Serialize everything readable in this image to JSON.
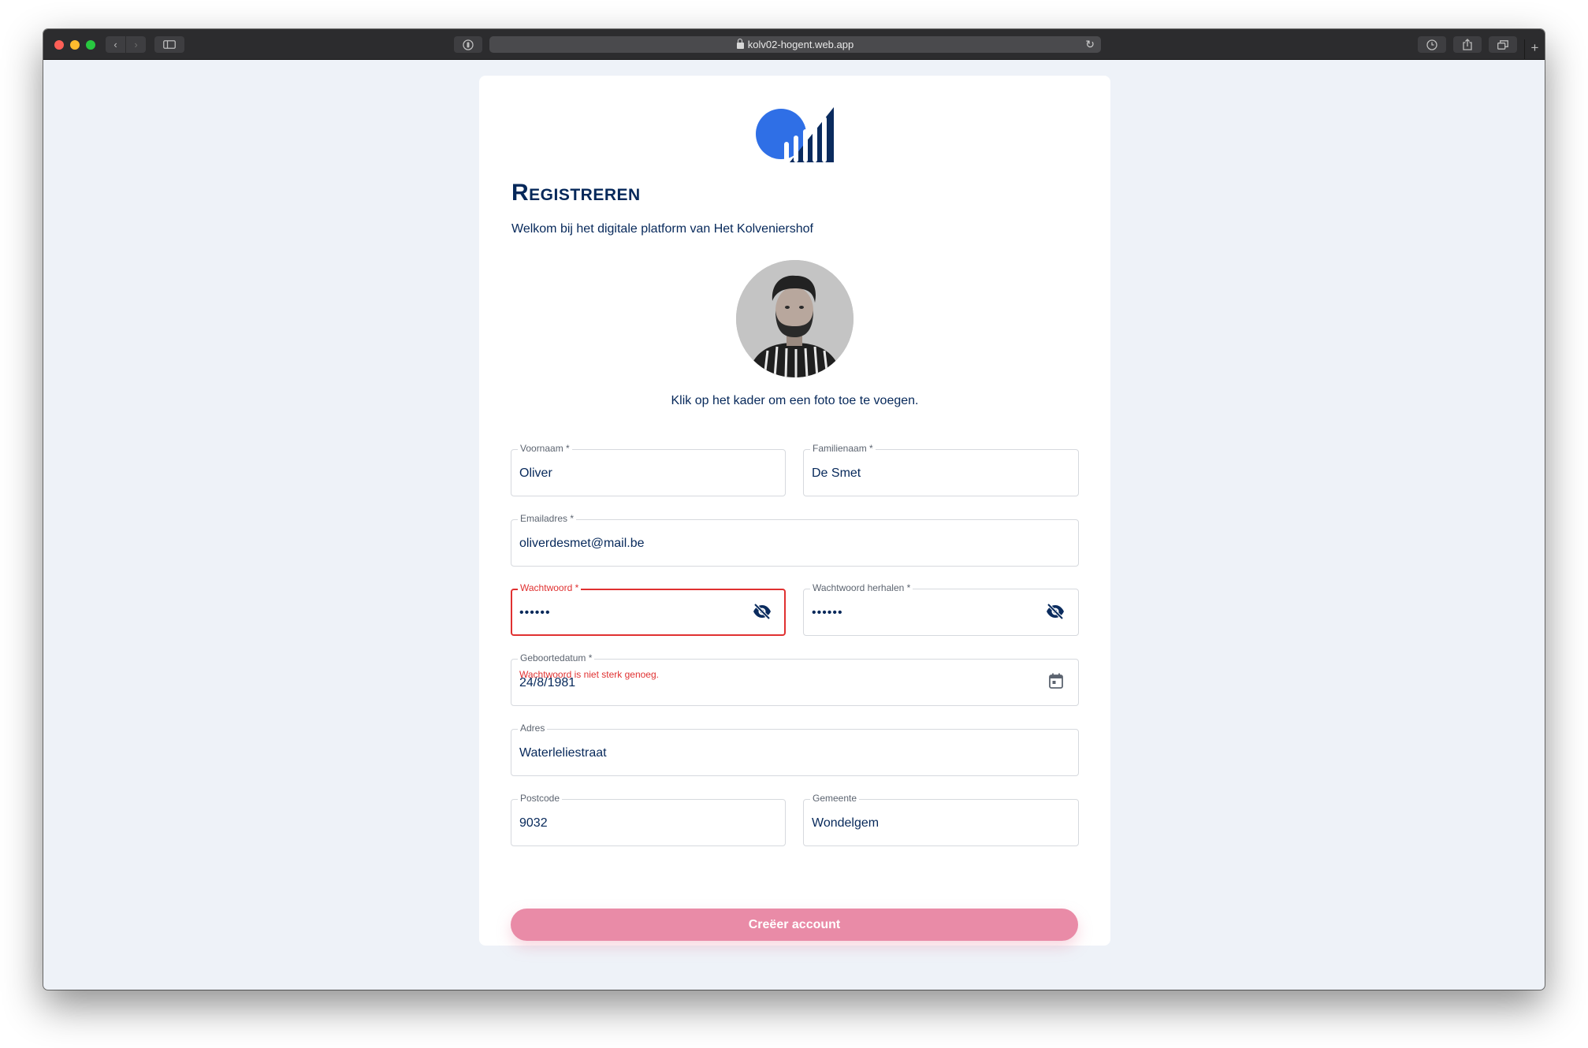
{
  "browser": {
    "url": "kolv02-hogent.web.app"
  },
  "page": {
    "title": "Registreren",
    "subtitle": "Welkom bij het digitale platform van Het Kolveniershof",
    "photo_hint": "Klik op het kader om een foto toe te voegen."
  },
  "form": {
    "voornaam": {
      "label": "Voornaam *",
      "value": "Oliver"
    },
    "familienaam": {
      "label": "Familienaam *",
      "value": "De Smet"
    },
    "email": {
      "label": "Emailadres *",
      "value": "oliverdesmet@mail.be"
    },
    "wachtwoord": {
      "label": "Wachtwoord *",
      "value": "••••••",
      "error": "Wachtwoord is niet sterk genoeg."
    },
    "wachtwoord_herhalen": {
      "label": "Wachtwoord herhalen *",
      "value": "••••••"
    },
    "geboortedatum": {
      "label": "Geboortedatum *",
      "value": "24/8/1981"
    },
    "adres": {
      "label": "Adres",
      "value": "Waterleliestraat"
    },
    "postcode": {
      "label": "Postcode",
      "value": "9032"
    },
    "gemeente": {
      "label": "Gemeente",
      "value": "Wondelgem"
    },
    "submit_label": "Creëer account"
  },
  "colors": {
    "brand_navy": "#06285a",
    "brand_blue": "#2f6fe6",
    "error": "#e03131",
    "submit_disabled": "#e98ba7"
  },
  "icons": {
    "password_toggle": "eye-off-icon",
    "date_picker": "calendar-icon"
  }
}
